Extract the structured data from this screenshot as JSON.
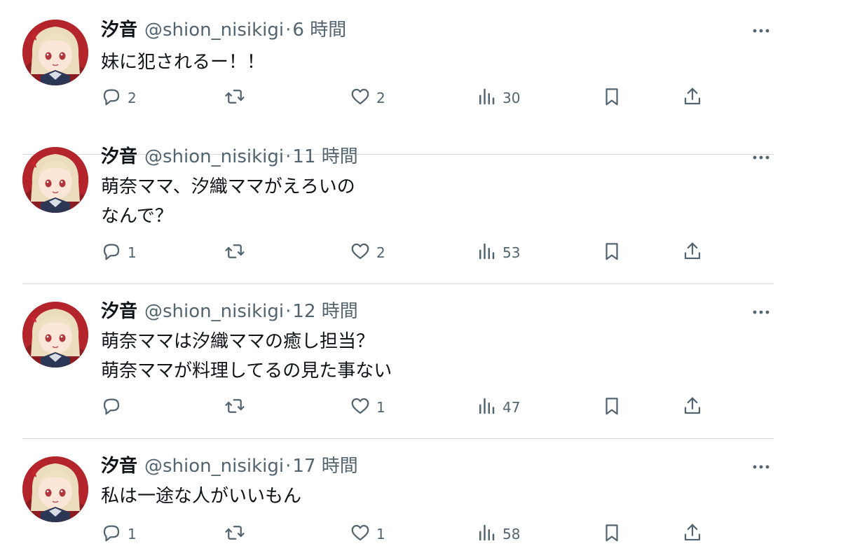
{
  "tweets": [
    {
      "name": "汐音",
      "handle": "@shion_nisikigi",
      "separator": "·",
      "time": "6 時間",
      "lines": [
        "妹に犯されるー！！"
      ],
      "replies": "2",
      "retweets": "",
      "likes": "2",
      "views": "30"
    },
    {
      "name": "汐音",
      "handle": "@shion_nisikigi",
      "separator": "·",
      "time": "11 時間",
      "lines": [
        "萌奈ママ、汐織ママがえろいの",
        "なんで？"
      ],
      "replies": "1",
      "retweets": "",
      "likes": "2",
      "views": "53"
    },
    {
      "name": "汐音",
      "handle": "@shion_nisikigi",
      "separator": "·",
      "time": "12 時間",
      "lines": [
        "萌奈ママは汐織ママの癒し担当？",
        "萌奈ママが料理してるの見た事ない"
      ],
      "replies": "",
      "retweets": "",
      "likes": "1",
      "views": "47"
    },
    {
      "name": "汐音",
      "handle": "@shion_nisikigi",
      "separator": "·",
      "time": "17 時間",
      "lines": [
        "私は一途な人がいいもん"
      ],
      "replies": "1",
      "retweets": "",
      "likes": "1",
      "views": "58"
    }
  ],
  "icons": {
    "more": "more-dots-icon",
    "reply": "reply-bubble-icon",
    "retweet": "retweet-arrows-icon",
    "like": "heart-icon",
    "views": "bar-chart-icon",
    "bookmark": "bookmark-icon",
    "share": "share-upload-icon"
  },
  "colors": {
    "text": "#0f1419",
    "secondary": "#536471",
    "divider": "#d9dde1",
    "avatar_bg": "#b3242b"
  }
}
